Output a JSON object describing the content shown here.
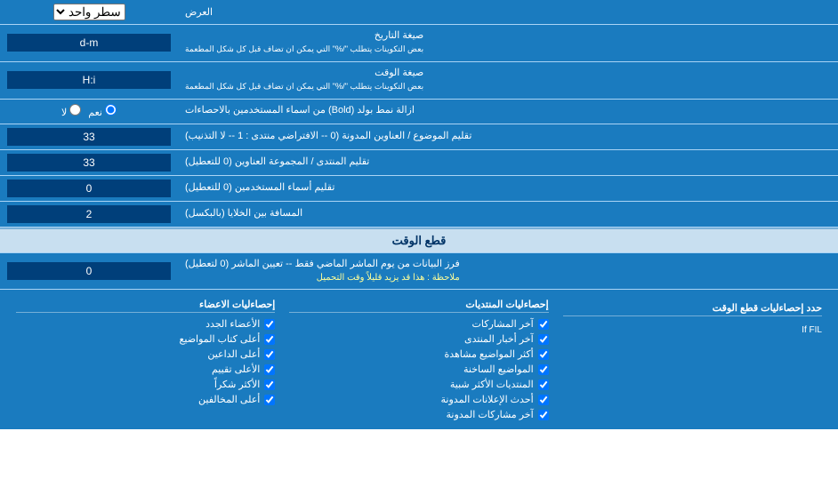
{
  "page": {
    "title": "العرض",
    "top_select_label": "سطر واحد",
    "rows": [
      {
        "id": "date_format",
        "label": "صيغة التاريخ\nبعض التكوينات يتطلب \"/%\" التي يمكن ان تضاف قبل كل شكل المطعمة",
        "value": "d-m"
      },
      {
        "id": "time_format",
        "label": "صيغة الوقت\nبعض التكوينات يتطلب \"/%\" التي يمكن ان تضاف قبل كل شكل المطعمة",
        "value": "H:i"
      },
      {
        "id": "bold_names",
        "label": "ازالة نمط بولد (Bold) من اسماء المستخدمين بالاحصاءات",
        "type": "radio",
        "options": [
          "نعم",
          "لا"
        ],
        "selected": "نعم"
      },
      {
        "id": "topic_address",
        "label": "تقليم الموضوع / العناوين المدونة (0 -- الافتراضي منتدى : 1 -- لا التذنيب)",
        "value": "33"
      },
      {
        "id": "forum_address",
        "label": "تقليم المنتدى / المجموعة العناوين (0 للتعطيل)",
        "value": "33"
      },
      {
        "id": "user_names",
        "label": "تقليم أسماء المستخدمين (0 للتعطيل)",
        "value": "0"
      },
      {
        "id": "space_cells",
        "label": "المسافة بين الخلايا (بالبكسل)",
        "value": "2"
      }
    ],
    "section_realtime": {
      "title": "قطع الوقت",
      "fetch_row": {
        "label": "فرز البيانات من يوم الماشر الماضي فقط -- تعيين الماشر (0 لتعطيل)\nملاحظة : هذا قد يزيد قليلاً وقت التحميل",
        "value": "0"
      },
      "limit_label": "حدد إحصاءليات قطع الوقت",
      "columns": [
        {
          "header": "إحصاءليات المنتديات",
          "items": [
            "آخر المشاركات",
            "آخر أخبار المنتدى",
            "أكثر المواضيع مشاهدة",
            "المواضيع الساخنة",
            "المنتديات الأكثر شبية",
            "أحدث الإعلانات المدونة",
            "آخر مشاركات المدونة"
          ]
        },
        {
          "header": "إحصاءليات الاعضاء",
          "items": [
            "الأعضاء الجدد",
            "أعلى كتاب المواضيع",
            "أعلى الداعين",
            "الأعلى تقييم",
            "الأكثر شكراً",
            "أعلى المخالفين"
          ]
        }
      ],
      "if_fil_text": "If FIL"
    }
  }
}
